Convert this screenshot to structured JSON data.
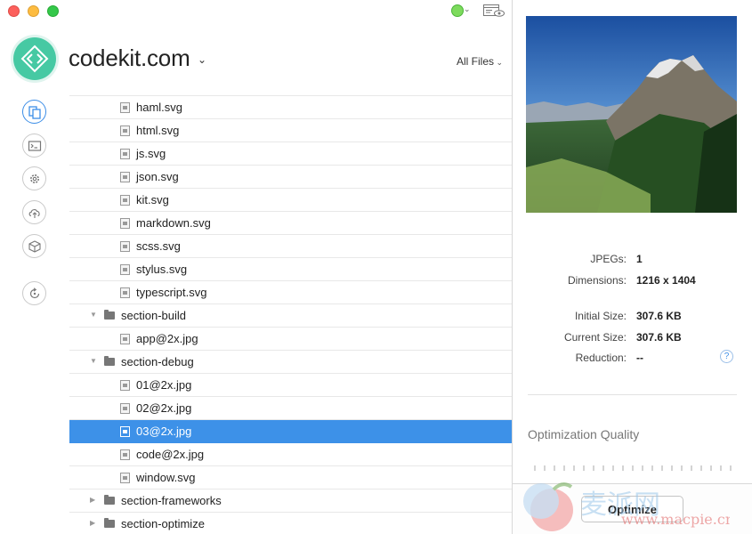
{
  "window": {
    "project_name": "codekit.com",
    "filter_label": "All Files"
  },
  "file_list": {
    "rows": [
      {
        "type": "file",
        "name": "haml.svg"
      },
      {
        "type": "file",
        "name": "html.svg"
      },
      {
        "type": "file",
        "name": "js.svg"
      },
      {
        "type": "file",
        "name": "json.svg"
      },
      {
        "type": "file",
        "name": "kit.svg"
      },
      {
        "type": "file",
        "name": "markdown.svg"
      },
      {
        "type": "file",
        "name": "scss.svg"
      },
      {
        "type": "file",
        "name": "stylus.svg"
      },
      {
        "type": "file",
        "name": "typescript.svg"
      },
      {
        "type": "folder",
        "name": "section-build",
        "expanded": true
      },
      {
        "type": "file",
        "name": "app@2x.jpg"
      },
      {
        "type": "folder",
        "name": "section-debug",
        "expanded": true
      },
      {
        "type": "file",
        "name": "01@2x.jpg"
      },
      {
        "type": "file",
        "name": "02@2x.jpg"
      },
      {
        "type": "file",
        "name": "03@2x.jpg",
        "selected": true
      },
      {
        "type": "file",
        "name": "code@2x.jpg"
      },
      {
        "type": "file",
        "name": "window.svg"
      },
      {
        "type": "folder",
        "name": "section-frameworks",
        "expanded": false
      },
      {
        "type": "folder",
        "name": "section-optimize",
        "expanded": false
      }
    ]
  },
  "inspector": {
    "jpegs_label": "JPEGs:",
    "jpegs_value": "1",
    "dimensions_label": "Dimensions:",
    "dimensions_value": "1216 x 1404",
    "initial_size_label": "Initial Size:",
    "initial_size_value": "307.6 KB",
    "current_size_label": "Current Size:",
    "current_size_value": "307.6 KB",
    "reduction_label": "Reduction:",
    "reduction_value": "--",
    "help_label": "?",
    "optimization_title": "Optimization Quality",
    "optimize_button": "Optimize"
  },
  "watermark": {
    "text": "麦派网",
    "url": "www.macpie.cn"
  },
  "colors": {
    "accent": "#3d91e8",
    "logo": "#46c9a3",
    "status_ok": "#7ddb5d"
  }
}
